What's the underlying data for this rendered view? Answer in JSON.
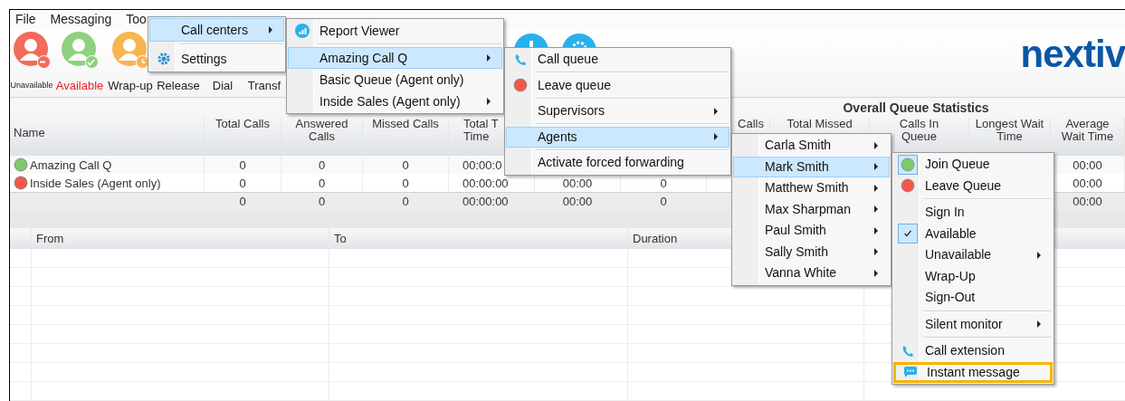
{
  "menu_bar": [
    {
      "label": "File"
    },
    {
      "label": "Messaging"
    },
    {
      "label": "Too"
    }
  ],
  "toolbar": [
    {
      "label": "Unavailable",
      "kind": "avatar-minus",
      "color": "#f26b5b",
      "selected": false
    },
    {
      "label": "Available",
      "kind": "avatar-check",
      "color": "#8fd17e",
      "selected": true
    },
    {
      "label": "Wrap-up",
      "kind": "avatar-clock",
      "color": "#f9b452",
      "selected": false
    },
    {
      "label": "Release",
      "kind": "covered",
      "selected": false
    },
    {
      "label": "Dial",
      "kind": "covered",
      "selected": false
    },
    {
      "label": "Transf",
      "kind": "covered",
      "selected": false
    }
  ],
  "logo": "nextiv",
  "queue_table": {
    "group_header": "Overall Queue Statistics",
    "columns": {
      "name": "Name",
      "total_calls": "Total Calls",
      "answered_calls": "Answered\nCalls",
      "missed_calls": "Missed Calls",
      "total_time": "Total T\nTime",
      "calls": "Calls",
      "total_missed": "Total Missed",
      "calls_in_queue": "Calls In\nQueue",
      "longest_wait_time": "Longest Wait\nTime",
      "average_wait_time": "Average\nWait Time"
    },
    "rows": [
      {
        "color": "#7dc96b",
        "name": "Amazing Call Q",
        "total_calls": "0",
        "answered_calls": "0",
        "missed_calls": "0",
        "total_time": "00:00:0",
        "average_wait_time": "00:00"
      },
      {
        "color": "#ef5a4a",
        "name": "Inside Sales (Agent only)",
        "total_calls": "0",
        "answered_calls": "0",
        "missed_calls": "0",
        "total_time": "00:00:00",
        "column_6": "00:00",
        "column_7": "0",
        "average_wait_time": "00:00"
      }
    ],
    "totals": {
      "total_calls": "0",
      "answered_calls": "0",
      "missed_calls": "0",
      "total_time": "00:00:00",
      "column_6": "00:00",
      "column_7": "0",
      "average_wait_time": "00:00"
    }
  },
  "calls_table": {
    "columns": [
      "From",
      "To",
      "Duration"
    ]
  },
  "menus": [
    {
      "items": [
        {
          "kind": "plain",
          "label": "Call centers",
          "selected": true,
          "submenu": true
        },
        {
          "kind": "separator"
        },
        {
          "kind": "gear",
          "label": "Settings",
          "selected": false,
          "submenu": false
        }
      ]
    },
    {
      "items": [
        {
          "kind": "chart",
          "label": "Report Viewer",
          "selected": false,
          "submenu": false
        },
        {
          "kind": "separator"
        },
        {
          "kind": "plain",
          "label": "Amazing Call Q",
          "selected": true,
          "submenu": true
        },
        {
          "kind": "plain",
          "label": "Basic Queue (Agent only)",
          "selected": false,
          "submenu": false
        },
        {
          "kind": "plain",
          "label": "Inside Sales (Agent only)",
          "selected": false,
          "submenu": true
        }
      ]
    },
    {
      "items": [
        {
          "kind": "phone",
          "label": "Call queue",
          "selected": false,
          "submenu": false
        },
        {
          "kind": "separator"
        },
        {
          "kind": "dot",
          "color": "#ef5a4a",
          "label": "Leave queue",
          "selected": false,
          "submenu": false
        },
        {
          "kind": "separator"
        },
        {
          "kind": "plain",
          "label": "Supervisors",
          "selected": false,
          "submenu": true
        },
        {
          "kind": "separator"
        },
        {
          "kind": "plain",
          "label": "Agents",
          "selected": true,
          "submenu": true
        },
        {
          "kind": "separator"
        },
        {
          "kind": "plain",
          "label": "Activate forced forwarding",
          "selected": false,
          "submenu": false
        }
      ]
    },
    {
      "items": [
        {
          "kind": "plain",
          "label": "Carla Smith",
          "selected": false,
          "submenu": true
        },
        {
          "kind": "plain",
          "label": "Mark Smith",
          "selected": true,
          "submenu": true
        },
        {
          "kind": "plain",
          "label": "Matthew Smith",
          "selected": false,
          "submenu": true
        },
        {
          "kind": "plain",
          "label": "Max Sharpman",
          "selected": false,
          "submenu": true
        },
        {
          "kind": "plain",
          "label": "Paul Smith",
          "selected": false,
          "submenu": true
        },
        {
          "kind": "plain",
          "label": "Sally Smith",
          "selected": false,
          "submenu": true
        },
        {
          "kind": "plain",
          "label": "Vanna White",
          "selected": false,
          "submenu": true
        }
      ]
    },
    {
      "items": [
        {
          "kind": "dot",
          "color": "#7dc96b",
          "label": "Join Queue",
          "selected": false,
          "submenu": false,
          "checked": false,
          "focused": true,
          "outlined": false
        },
        {
          "kind": "dot",
          "color": "#ef5a4a",
          "label": "Leave Queue",
          "selected": false,
          "submenu": false,
          "checked": false,
          "focused": false,
          "outlined": false
        },
        {
          "kind": "separator"
        },
        {
          "kind": "plain",
          "label": "Sign In",
          "selected": false,
          "submenu": false,
          "checked": false,
          "focused": false,
          "outlined": false
        },
        {
          "kind": "plain",
          "label": "Available",
          "selected": false,
          "submenu": false,
          "checked": true,
          "focused": false,
          "outlined": false
        },
        {
          "kind": "plain",
          "label": "Unavailable",
          "selected": false,
          "submenu": true,
          "checked": false,
          "focused": false,
          "outlined": false
        },
        {
          "kind": "plain",
          "label": "Wrap-Up",
          "selected": false,
          "submenu": false,
          "checked": false,
          "focused": false,
          "outlined": false
        },
        {
          "kind": "plain",
          "label": "Sign-Out",
          "selected": false,
          "submenu": false,
          "checked": false,
          "focused": false,
          "outlined": false
        },
        {
          "kind": "separator"
        },
        {
          "kind": "plain",
          "label": "Silent monitor",
          "selected": false,
          "submenu": true,
          "checked": false,
          "focused": false,
          "outlined": false
        },
        {
          "kind": "separator"
        },
        {
          "kind": "phone",
          "label": "Call extension",
          "selected": false,
          "submenu": false,
          "checked": false,
          "focused": false,
          "outlined": false
        },
        {
          "kind": "chat",
          "label": "Instant message",
          "selected": false,
          "submenu": false,
          "checked": false,
          "focused": false,
          "outlined": true
        }
      ]
    }
  ]
}
